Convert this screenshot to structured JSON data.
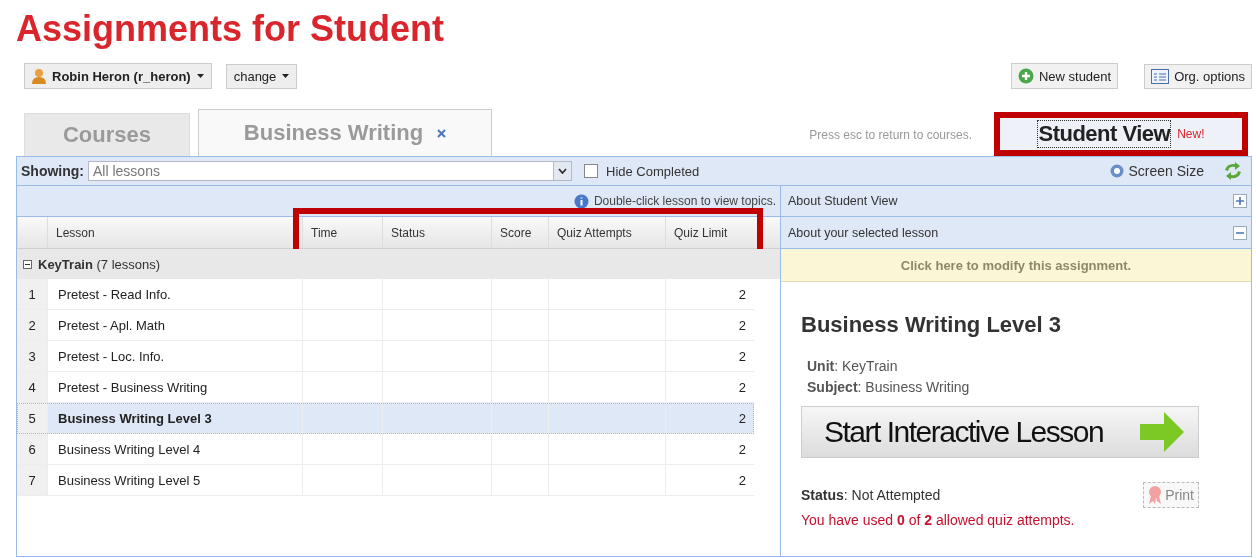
{
  "page": {
    "title": "Assignments for Student"
  },
  "student_menu": {
    "label": "Robin Heron (r_heron)"
  },
  "change_menu": {
    "label": "change"
  },
  "actions": [
    {
      "label": "New student",
      "kind": "add"
    },
    {
      "label": "Org. options",
      "kind": "options"
    }
  ],
  "tabs": [
    {
      "label": "Courses",
      "selected": false,
      "closable": false
    },
    {
      "label": "Business Writing",
      "selected": true,
      "closable": true
    }
  ],
  "esc_hint": "Press esc to return to courses.",
  "student_view": {
    "label": "Student View",
    "badge": "New!",
    "highlighted": true
  },
  "filter": {
    "label": "Showing:",
    "value": "All lessons"
  },
  "hide_completed": {
    "label": "Hide Completed",
    "checked": false
  },
  "screen_size": "Screen Size",
  "grid": {
    "hint": "Double-click lesson to view topics.",
    "columns": [
      {
        "label": "Lesson",
        "highlighted": false
      },
      {
        "label": "Time",
        "highlighted": true
      },
      {
        "label": "Status",
        "highlighted": true
      },
      {
        "label": "Score",
        "highlighted": true
      },
      {
        "label": "Quiz Attempts",
        "highlighted": true
      },
      {
        "label": "Quiz Limit",
        "highlighted": true
      }
    ],
    "group": {
      "name": "KeyTrain",
      "count": "(7 lessons)",
      "expanded": true
    },
    "rows": [
      {
        "number": "1",
        "lesson": "Pretest - Read Info.",
        "quiz_limit": "2",
        "selected": false
      },
      {
        "number": "2",
        "lesson": "Pretest - Apl. Math",
        "quiz_limit": "2",
        "selected": false
      },
      {
        "number": "3",
        "lesson": "Pretest - Loc. Info.",
        "quiz_limit": "2",
        "selected": false
      },
      {
        "number": "4",
        "lesson": "Pretest - Business Writing",
        "quiz_limit": "2",
        "selected": false
      },
      {
        "number": "5",
        "lesson": "Business Writing Level 3",
        "quiz_limit": "2",
        "selected": true
      },
      {
        "number": "6",
        "lesson": "Business Writing Level 4",
        "quiz_limit": "2",
        "selected": false
      },
      {
        "number": "7",
        "lesson": "Business Writing Level 5",
        "quiz_limit": "2",
        "selected": false
      }
    ]
  },
  "panel": {
    "sections": [
      {
        "label": "About Student View",
        "expanded": false
      },
      {
        "label": "About your selected lesson",
        "expanded": true
      }
    ],
    "modify_link": "Click here to modify this assignment.",
    "lesson_title": "Business Writing Level 3",
    "unit": "**Unit**: KeyTrain",
    "subject": "**Subject**: Business Writing",
    "start_button": "Start Interactive Lesson",
    "status": "**Status**: Not Attempted",
    "print": {
      "label": "Print",
      "disabled": true
    },
    "attempts": "You have used **0** of **2** allowed quiz attempts."
  }
}
